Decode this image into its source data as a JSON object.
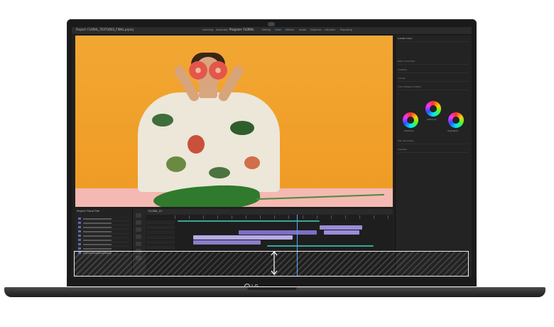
{
  "app": {
    "project_title": "Project: FLORAL_TEXTURES_FINAL.prproj",
    "center_label": "Program: FLORAL",
    "workspaces": [
      "Learning",
      "Assembly",
      "Editing",
      "Color",
      "Effects",
      "Audio",
      "Graphics",
      "Libraries",
      "Exporting"
    ],
    "active_workspace": "Color"
  },
  "monitor": {
    "subject": "woman-holding-grapefruit-halves"
  },
  "right_panel": {
    "title": "Lumetri Color",
    "rows": [
      "Basic Correction",
      "Creative",
      "Curves",
      "Color Wheels & Match",
      "HSL Secondary",
      "Vignette"
    ],
    "wheels": [
      "Shadows",
      "Midtones",
      "Highlights"
    ]
  },
  "timeline": {
    "label": "FLORAL_01",
    "project_label": "Project: Floral Film"
  },
  "brand": {
    "logo_text": "LG"
  },
  "colors": {
    "accent": "#5aa7ff",
    "clip_purple": "#9b8cd8",
    "clip_teal": "#3aa59a",
    "highlight": "#eaeaea"
  }
}
